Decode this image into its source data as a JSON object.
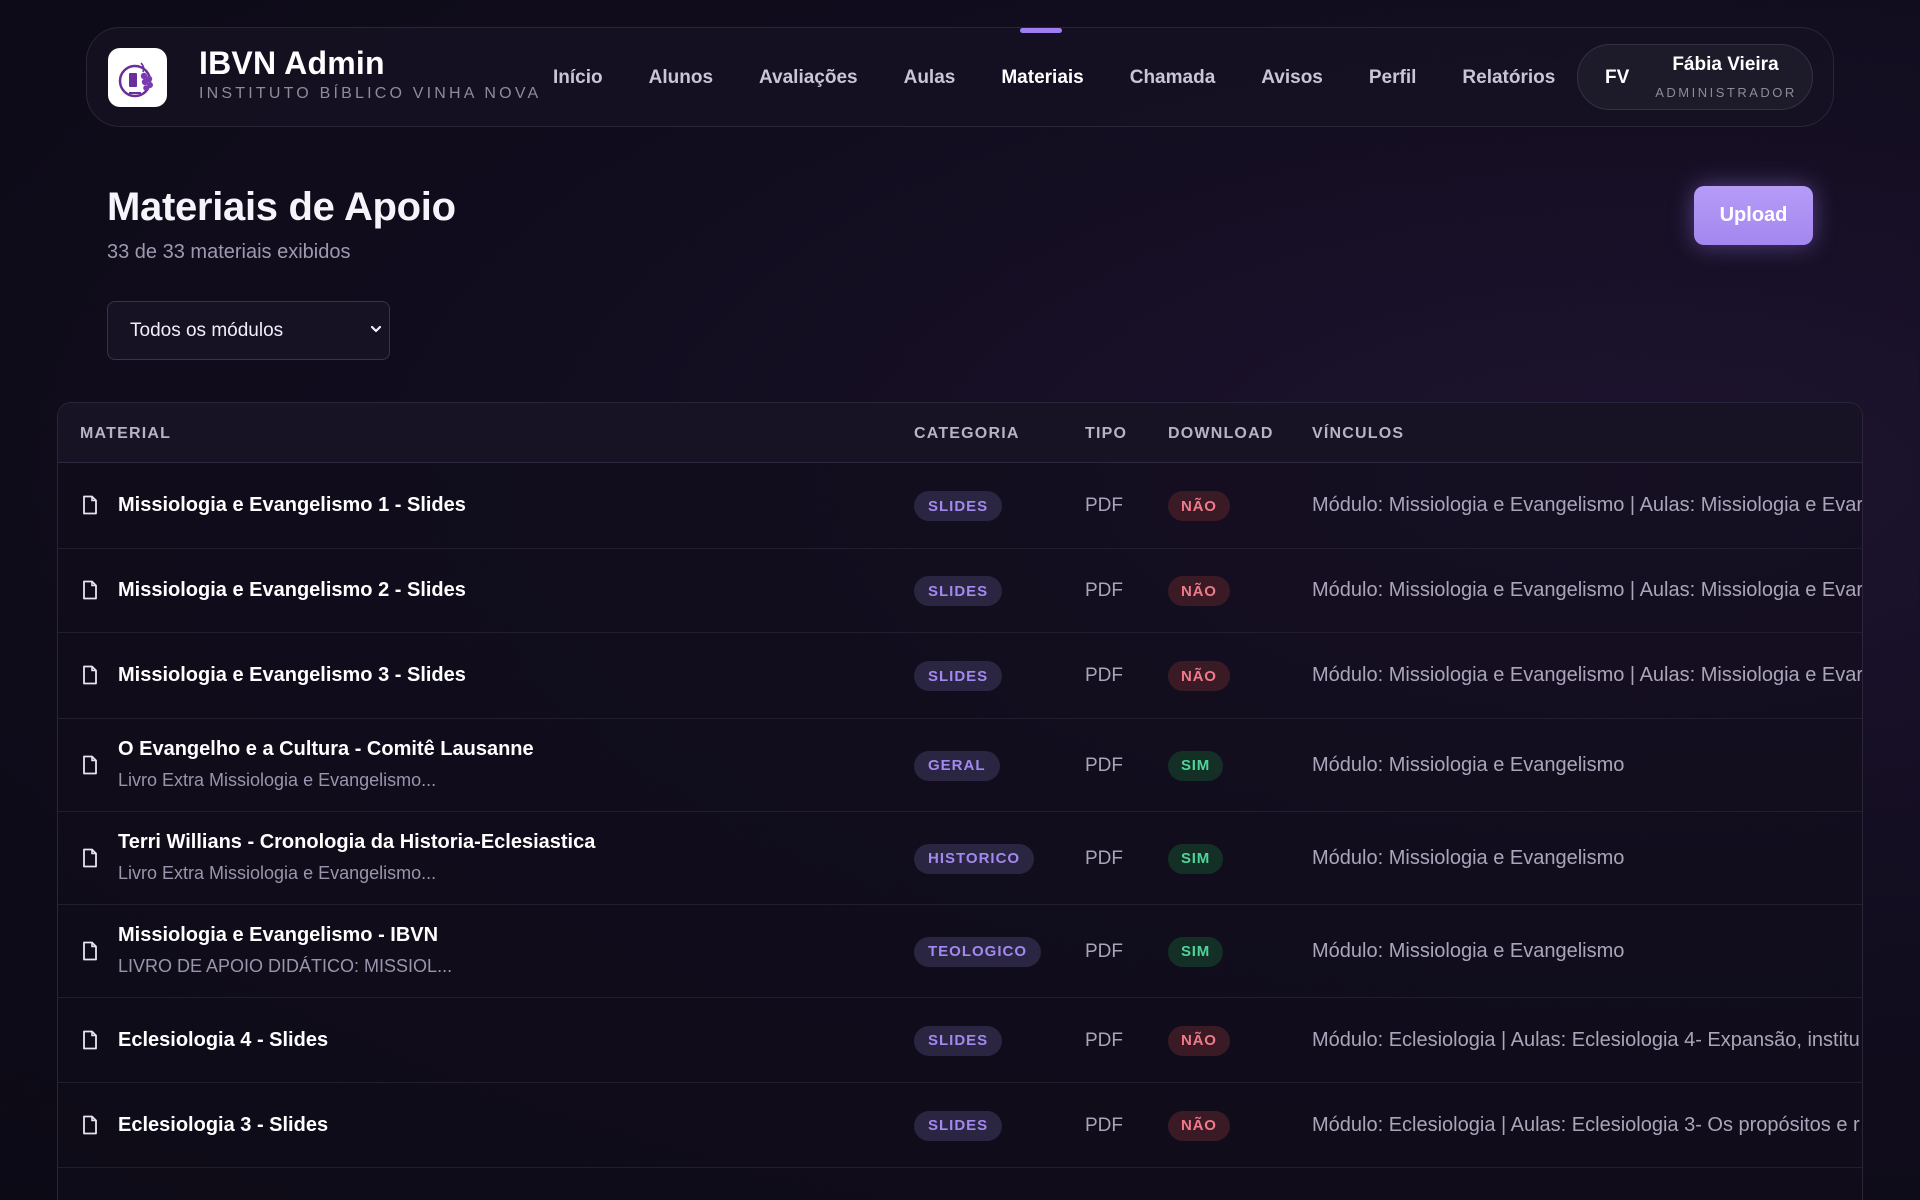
{
  "brand": {
    "title": "IBVN Admin",
    "subtitle": "INSTITUTO BÍBLICO VINHA NOVA"
  },
  "nav": {
    "items": [
      "Início",
      "Alunos",
      "Avaliações",
      "Aulas",
      "Materiais",
      "Chamada",
      "Avisos",
      "Perfil",
      "Relatórios"
    ],
    "active": "Materiais"
  },
  "user": {
    "initials": "FV",
    "name": "Fábia Vieira",
    "role": "ADMINISTRADOR"
  },
  "page": {
    "title": "Materiais de Apoio",
    "subtitle": "33 de 33 materiais exibidos",
    "upload_label": "Upload",
    "module_filter": "Todos os módulos"
  },
  "table": {
    "headers": {
      "material": "MATERIAL",
      "categoria": "CATEGORIA",
      "tipo": "TIPO",
      "download": "DOWNLOAD",
      "vinculos": "VÍNCULOS"
    },
    "rows": [
      {
        "title": "Missiologia e Evangelismo 1 - Slides",
        "desc": "",
        "categoria": "SLIDES",
        "tipo": "PDF",
        "download": "NÃO",
        "vinculos": "Módulo: Missiologia e Evangelismo | Aulas: Missiologia e Evar"
      },
      {
        "title": "Missiologia e Evangelismo 2 - Slides",
        "desc": "",
        "categoria": "SLIDES",
        "tipo": "PDF",
        "download": "NÃO",
        "vinculos": "Módulo: Missiologia e Evangelismo | Aulas: Missiologia e Evar"
      },
      {
        "title": "Missiologia e Evangelismo 3 - Slides",
        "desc": "",
        "categoria": "SLIDES",
        "tipo": "PDF",
        "download": "NÃO",
        "vinculos": "Módulo: Missiologia e Evangelismo | Aulas: Missiologia e Evar"
      },
      {
        "title": "O Evangelho e a Cultura - Comitê Lausanne",
        "desc": "Livro Extra Missiologia e Evangelismo...",
        "categoria": "GERAL",
        "tipo": "PDF",
        "download": "SIM",
        "vinculos": "Módulo: Missiologia e Evangelismo"
      },
      {
        "title": "Terri Willians - Cronologia da Historia-Eclesiastica",
        "desc": "Livro Extra Missiologia e Evangelismo...",
        "categoria": "HISTORICO",
        "tipo": "PDF",
        "download": "SIM",
        "vinculos": "Módulo: Missiologia e Evangelismo"
      },
      {
        "title": "Missiologia e Evangelismo - IBVN",
        "desc": "LIVRO DE APOIO DIDÁTICO: MISSIOL...",
        "categoria": "TEOLOGICO",
        "tipo": "PDF",
        "download": "SIM",
        "vinculos": "Módulo: Missiologia e Evangelismo"
      },
      {
        "title": "Eclesiologia 4 - Slides",
        "desc": "",
        "categoria": "SLIDES",
        "tipo": "PDF",
        "download": "NÃO",
        "vinculos": "Módulo: Eclesiologia | Aulas: Eclesiologia 4- Expansão, institu"
      },
      {
        "title": "Eclesiologia 3 - Slides",
        "desc": "",
        "categoria": "SLIDES",
        "tipo": "PDF",
        "download": "NÃO",
        "vinculos": "Módulo: Eclesiologia | Aulas: Eclesiologia 3- Os propósitos e r"
      }
    ]
  },
  "colors": {
    "accent": "#a07ef2",
    "no": "#f07a8a",
    "yes": "#4fd39a"
  }
}
